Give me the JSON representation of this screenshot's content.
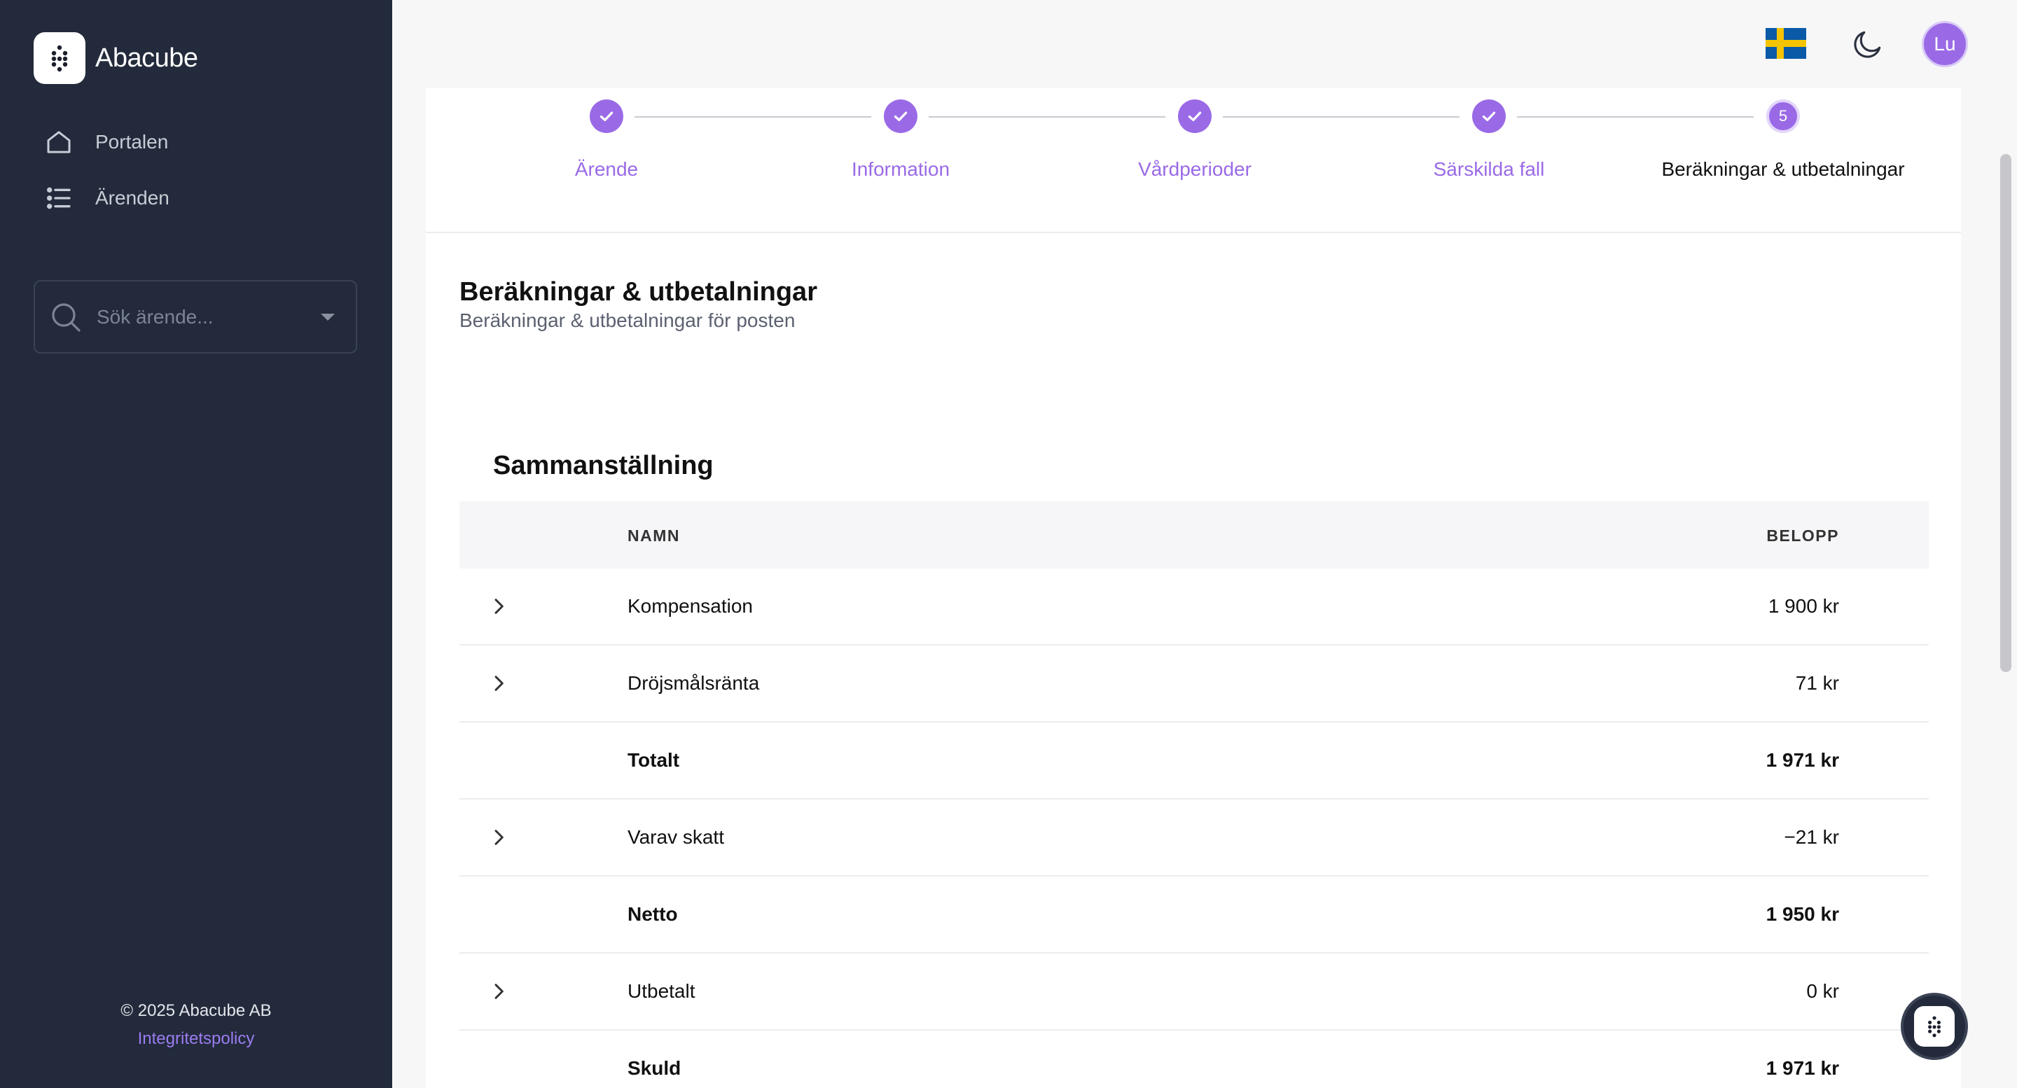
{
  "brand": {
    "name": "Abacube"
  },
  "sidebar": {
    "items": [
      {
        "label": "Portalen",
        "icon": "home-icon"
      },
      {
        "label": "Ärenden",
        "icon": "list-icon"
      }
    ],
    "search": {
      "placeholder": "Sök ärende..."
    },
    "footer": {
      "copyright": "© 2025 Abacube AB",
      "link": "Integritetspolicy"
    }
  },
  "topbar": {
    "avatar_initials": "Lu",
    "flag": "sweden-flag-icon",
    "theme_icon": "moon-icon"
  },
  "stepper": {
    "steps": [
      {
        "label": "Ärende",
        "state": "done"
      },
      {
        "label": "Information",
        "state": "done"
      },
      {
        "label": "Vårdperioder",
        "state": "done"
      },
      {
        "label": "Särskilda fall",
        "state": "done"
      },
      {
        "label": "Beräkningar & utbetalningar",
        "state": "active",
        "number": "5"
      }
    ]
  },
  "section": {
    "title": "Beräkningar & utbetalningar",
    "subtitle": "Beräkningar & utbetalningar för posten"
  },
  "summary": {
    "title": "Sammanställning",
    "columns": {
      "name": "NAMN",
      "amount": "BELOPP"
    },
    "rows": [
      {
        "name": "Kompensation",
        "amount": "1 900 kr",
        "expandable": true,
        "bold": false
      },
      {
        "name": "Dröjsmålsränta",
        "amount": "71 kr",
        "expandable": true,
        "bold": false
      },
      {
        "name": "Totalt",
        "amount": "1 971 kr",
        "expandable": false,
        "bold": true
      },
      {
        "name": "Varav skatt",
        "amount": "−21 kr",
        "expandable": true,
        "bold": false
      },
      {
        "name": "Netto",
        "amount": "1 950 kr",
        "expandable": false,
        "bold": true
      },
      {
        "name": "Utbetalt",
        "amount": "0 kr",
        "expandable": true,
        "bold": false
      },
      {
        "name": "Skuld",
        "amount": "1 971 kr",
        "expandable": false,
        "bold": true
      }
    ]
  },
  "colors": {
    "sidebar_bg": "#222a3b",
    "accent": "#9a6ae6",
    "page_bg": "#f7f7f8"
  }
}
